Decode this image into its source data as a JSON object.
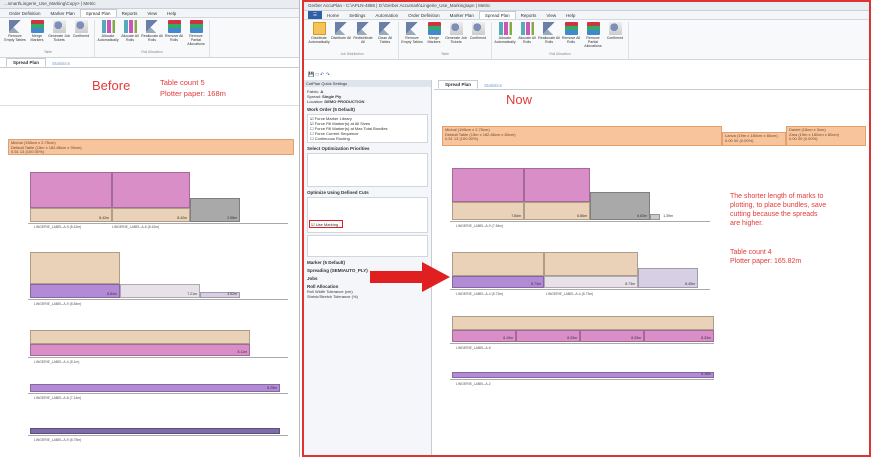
{
  "left": {
    "title": "...smart\\Lingerie_Use_Marking\\Copy> | Metric",
    "menu": [
      "Order Definition",
      "Marker Plan",
      "Spread Plan",
      "Reports",
      "View",
      "Help"
    ],
    "menu_active": 2,
    "ribbon_groups": [
      {
        "buttons": [
          "Remove Empty Tables",
          "Merge Markers",
          "Generate Job Tickets",
          "Confirmed"
        ],
        "label": "Table"
      },
      {
        "buttons": [
          "Allocate Automatically",
          "Allocate All Rolls",
          "Reallocate All Rolls",
          "Remove All Rolls",
          "Remove Partial Allocations"
        ],
        "label": "Roll Allocation"
      }
    ],
    "tabs": [
      "Spread Plan",
      "Statistics"
    ],
    "tab_active": 0,
    "before_label": "Before",
    "note_lines": [
      "Table count 5",
      "Plotter paper: 168m"
    ],
    "orange_header": [
      "Michal (198cm x 2.75cm)",
      "Default Table (15m x 182.86cm x 90cm)",
      "0.51 13 (100.00%)"
    ],
    "mark_values": [
      "8.42m",
      "8.42m",
      "2.58m",
      "8.84m",
      "7.21m",
      "3.52m",
      "8.11m",
      "8.25m"
    ],
    "row_labels": [
      "LINGERIE_LABEL-A-9 (8.42m)",
      "LINGERIE_LABEL-A-6 (8.42m)",
      "LINGERIE_LABEL-A-9 (8.84m)",
      "LINGERIE_LABEL-A-4 (8.1m)",
      "LINGERIE_LABEL-A-8 (7.14m)",
      "LINGERIE_LABEL-A-9 (8.75m)"
    ]
  },
  "right": {
    "title": "Gerber AccuPlan - C:\\APLN-4886 | D:\\Gerber Accumark\\Lingerie_Use_Marking\\apn | Metric",
    "menu": [
      "Home",
      "Settings",
      "Automation",
      "Order Definition",
      "Marker Plan",
      "Spread Plan",
      "Reports",
      "View",
      "Help"
    ],
    "menu_active": 5,
    "ribbon_groups": [
      {
        "buttons": [
          "Distribute Automatically",
          "Distribute All",
          "Redistribute All",
          "Clean All Tables"
        ],
        "label": "Job Distribution"
      },
      {
        "buttons": [
          "Remove Empty Tables",
          "Merge Markers",
          "Generate Job Tickets",
          "Confirmed"
        ],
        "label": "Table"
      },
      {
        "buttons": [
          "Allocate Automatically",
          "Allocate All Rolls",
          "Reallocate All Rolls",
          "Remove All Rolls",
          "Remove Partial Allocations",
          "Confirmed"
        ],
        "label": "Roll Allocation"
      }
    ],
    "tabs": [
      "Spread Plan",
      "Statistics"
    ],
    "tab_active": 0,
    "now_label": "Now",
    "annotation_lines": [
      "The shorter length of marks to",
      "plotting, to place bundles, save",
      "cutting because the spreads",
      "are higher."
    ],
    "note_lines": [
      "Table count 4",
      "Plotter paper: 165.82m"
    ],
    "orange_header": [
      "Michal (198cm x 2.75cm)",
      "Default Table (15m x 182.86cm x 80cm)",
      "0.51 13 (100.00%)"
    ],
    "orange_header_2": [
      "Lanva (19m x 180cm x 80cm)",
      "0.00 00 (0.00%)"
    ],
    "orange_header_3": [
      "Daniel (18cm x 3cm)",
      "Zara (19m x 180cm x 80cm)",
      "0.00 00 (0.00%)"
    ],
    "mark_values": [
      "7.84m",
      "6.86m",
      "6.63m",
      "1.39m",
      "8.73m",
      "8.73m",
      "8.45m",
      "6.19m",
      "8.33m",
      "8.33m",
      "8.33m",
      "6.18m",
      "8.57m"
    ],
    "row_labels": [
      "LINGERIE_LABEL-A-9 (7.84m)",
      "LINGERIE_LABEL-A-4 (8.73m)",
      "LINGERIE_LABEL-A-4 (8.73m)",
      "LINGERIE_LABEL-A-6",
      "LINGERIE_LABEL-A-2"
    ]
  },
  "quick_settings": {
    "title": "CutPlan Quick Settings",
    "fabric_label": "Fabric:",
    "fabric": "A",
    "spread_label": "Spread:",
    "spread": "Single Ply",
    "location_label": "Location:",
    "location": "DEMO PRODUCTION",
    "sections": [
      "Work Order (5 Default)",
      "Select Optimization Priorities",
      "Optimize Using Defined Cuts",
      "Marker (5 Default)",
      "Spreading (SEMIAUTO_PLY)",
      "Jobs",
      "Roll Allocation"
    ],
    "checks": [
      "Force Marker Library",
      "Force Fill Marker(s) at All Sizes",
      "Force Fill Marker(s) at Max Total Bundles",
      "Force Current Sequence",
      "Continuous Routing"
    ],
    "highlight_option": "Use Marking",
    "roll_fields": [
      "Roll Width Tolerance (cm)",
      "Shrink/Stretch Tolerance (%)"
    ]
  },
  "colors": {
    "accent_red": "#e23b3b",
    "orange_bar": "#f8c49c",
    "pink": "#d98ec8",
    "tan": "#ead2b8",
    "gray": "#a9a9a9",
    "purple": "#b38ad6"
  }
}
